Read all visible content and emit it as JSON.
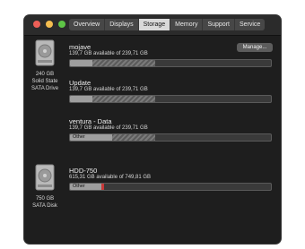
{
  "tabs": [
    "Overview",
    "Displays",
    "Storage",
    "Memory",
    "Support",
    "Service"
  ],
  "active_tab": "Storage",
  "drives": [
    {
      "capacity": "240 GB",
      "type_line1": "Solid State",
      "type_line2": "SATA Drive"
    },
    {
      "capacity": "750 GB",
      "type_line1": "SATA Disk"
    }
  ],
  "volumes": [
    {
      "name": "mojave",
      "info": "139,7 GB available of 239,71 GB",
      "button": "Manage..."
    },
    {
      "name": "Update",
      "info": "139,7 GB available of 239,71 GB"
    },
    {
      "name": "ventura - Data",
      "info": "139,7 GB available of 239,71 GB",
      "bar_label": "Other"
    },
    {
      "name": "HDD-750",
      "info": "615,31 GB available of 749,81 GB",
      "bar_label": "Other"
    }
  ],
  "colors": {
    "window_bg": "#1e1e1e",
    "other_segment": "#9e9e9e",
    "accent_red": "#c73838"
  }
}
